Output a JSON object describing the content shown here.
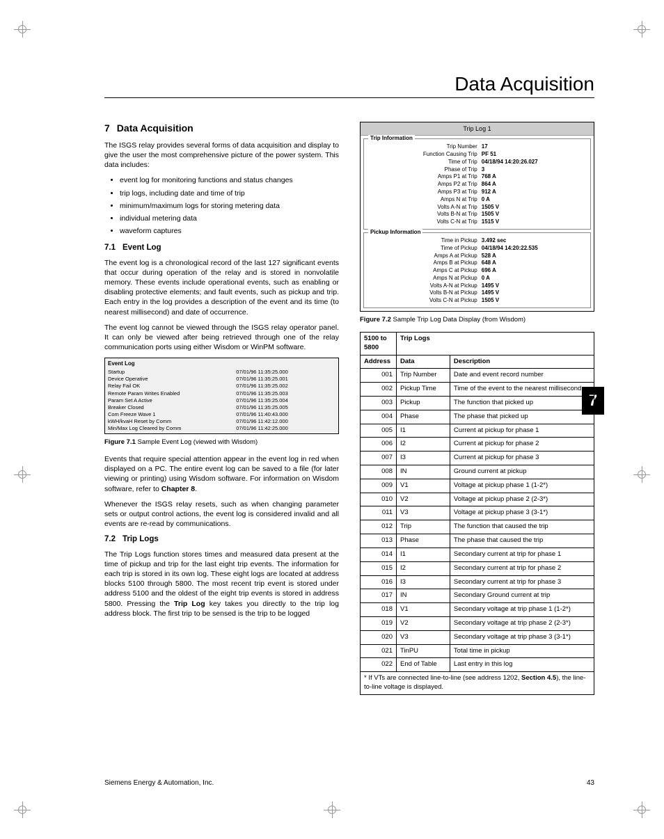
{
  "pageTitle": "Data Acquisition",
  "chapterTab": "7",
  "h7": {
    "num": "7",
    "title": "Data Acquisition"
  },
  "intro": "The ISGS relay provides several forms of data acquisition and display to give the user the most comprehensive picture of the power system. This data includes:",
  "bullets": [
    "event log for monitoring functions and status changes",
    "trip logs, including date and time of trip",
    "minimum/maximum logs for storing metering data",
    "individual metering data",
    "waveform captures"
  ],
  "h71": {
    "num": "7.1",
    "title": "Event Log"
  },
  "p71a": "The event log is a chronological record of the last 127 significant events that occur during operation of the relay and is stored in nonvolatile memory. These events include operational events, such as enabling or disabling protective elements; and fault events, such as pickup and trip. Each entry in the log provides a description of the event and its time (to nearest millisecond) and date of occurrence.",
  "p71b": "The event log cannot be viewed through the ISGS relay operator panel. It can only be viewed after being retrieved through one of the relay communication ports using either Wisdom or WinPM software.",
  "eventLog": {
    "header": "Event Log",
    "rows": [
      {
        "name": "Startup",
        "ts": "07/01/96 11:35:25.000"
      },
      {
        "name": "Device Operative",
        "ts": "07/01/96 11:35:25.001"
      },
      {
        "name": "Relay Fail OK",
        "ts": "07/01/96 11:35:25.002"
      },
      {
        "name": "Remote Param Writes Enabled",
        "ts": "07/01/96 11:35:25.003"
      },
      {
        "name": "Param Set A Active",
        "ts": "07/01/96 11:35:25.004"
      },
      {
        "name": "Breaker Closed",
        "ts": "07/01/96 11:35:25.005"
      },
      {
        "name": "Com Freeze Wave 1",
        "ts": "07/01/96 11:40:43.000"
      },
      {
        "name": "kWH/kvaH Reset by Comm",
        "ts": "07/01/96 11:42:12.000"
      },
      {
        "name": "Min/Max Log Cleared by Comm",
        "ts": "07/01/96 11:42:25.000"
      }
    ]
  },
  "fig71_label": "Figure 7.1",
  "fig71_text": " Sample Event Log (viewed with Wisdom)",
  "p71c_a": "Events that require special attention appear in the event log in red when displayed on a PC. The entire event log can be saved to a file (for later viewing or printing) using Wisdom software. For information on Wisdom software, refer to ",
  "p71c_bold": "Chapter 8",
  "p71c_b": ".",
  "p71d": "Whenever the ISGS relay resets, such as when changing parameter sets or output control actions, the event log is considered invalid and all events are re-read by communications.",
  "h72": {
    "num": "7.2",
    "title": "Trip Logs"
  },
  "p72a_a": "The Trip Logs function stores times and measured data present at the time of pickup and trip for the last eight trip events. The information for each trip is stored in its own log. These eight logs are located at address blocks 5100 through 5800. The most recent trip event is stored under address 5100 and the oldest of the eight trip events is stored in address 5800. Pressing the ",
  "p72a_bold": "Trip Log",
  "p72a_b": " key takes you directly to the trip log address block. The first trip to be sensed is the trip to be logged",
  "tripBox": {
    "title": "Trip Log 1",
    "tripInfoLegend": "Trip Information",
    "tripInfo": [
      {
        "k": "Trip Number",
        "v": "17"
      },
      {
        "k": "Function Causing Trip",
        "v": "PF 51"
      },
      {
        "k": "Time of Trip",
        "v": "04/18/94 14:20:26.027"
      },
      {
        "k": "Phase of Trip",
        "v": "3"
      },
      {
        "k": "Amps P1 at Trip",
        "v": "768 A"
      },
      {
        "k": "Amps P2 at Trip",
        "v": "864 A"
      },
      {
        "k": "Amps P3 at Trip",
        "v": "912 A"
      },
      {
        "k": "Amps N at Trip",
        "v": "0 A"
      },
      {
        "k": "Volts A-N at Trip",
        "v": "1505 V"
      },
      {
        "k": "Volts B-N at Trip",
        "v": "1505 V"
      },
      {
        "k": "Volts C-N at Trip",
        "v": "1515 V"
      }
    ],
    "pickupInfoLegend": "Pickup Information",
    "pickupInfo": [
      {
        "k": "Time in Pickup",
        "v": "3.492 sec"
      },
      {
        "k": "Time of Pickup",
        "v": "04/18/94 14:20:22.535"
      },
      {
        "k": "Amps A at Pickup",
        "v": "528 A"
      },
      {
        "k": "Amps B at Pickup",
        "v": "648 A"
      },
      {
        "k": "Amps C at Pickup",
        "v": "696 A"
      },
      {
        "k": "Amps N at Pickup",
        "v": "0 A"
      },
      {
        "k": "Volts A-N at Pickup",
        "v": "1495 V"
      },
      {
        "k": "Volts B-N at Pickup",
        "v": "1495 V"
      },
      {
        "k": "Volts C-N at Pickup",
        "v": "1505 V"
      }
    ]
  },
  "fig72_label": "Figure 7.2",
  "fig72_text": " Sample Trip Log Data Display (from Wisdom)",
  "tripTable": {
    "range": "5100 to 5800",
    "rangeLabel": "Trip Logs",
    "cols": {
      "addr": "Address",
      "data": "Data",
      "desc": "Description"
    },
    "rows": [
      {
        "a": "001",
        "d": "Trip Number",
        "desc": "Date and event record number"
      },
      {
        "a": "002",
        "d": "Pickup Time",
        "desc": "Time of the event to the nearest millisecond"
      },
      {
        "a": "003",
        "d": "Pickup",
        "desc": "The function that picked up"
      },
      {
        "a": "004",
        "d": "Phase",
        "desc": "The phase that picked up"
      },
      {
        "a": "005",
        "d": "I1",
        "desc": "Current at pickup for phase 1"
      },
      {
        "a": "006",
        "d": "I2",
        "desc": "Current at pickup for phase 2"
      },
      {
        "a": "007",
        "d": "I3",
        "desc": "Current at pickup for phase 3"
      },
      {
        "a": "008",
        "d": "IN",
        "desc": "Ground current at pickup"
      },
      {
        "a": "009",
        "d": "V1",
        "desc": "Voltage at pickup phase 1 (1-2*)"
      },
      {
        "a": "010",
        "d": "V2",
        "desc": "Voltage at pickup phase 2 (2-3*)"
      },
      {
        "a": "011",
        "d": "V3",
        "desc": "Voltage at pickup phase 3 (3-1*)"
      },
      {
        "a": "012",
        "d": "Trip",
        "desc": "The function that caused the trip"
      },
      {
        "a": "013",
        "d": "Phase",
        "desc": "The phase that caused the trip"
      },
      {
        "a": "014",
        "d": "I1",
        "desc": "Secondary current at trip for phase 1"
      },
      {
        "a": "015",
        "d": "I2",
        "desc": "Secondary current at trip for phase 2"
      },
      {
        "a": "016",
        "d": "I3",
        "desc": "Secondary current at trip for phase 3"
      },
      {
        "a": "017",
        "d": "IN",
        "desc": "Secondary Ground current at trip"
      },
      {
        "a": "018",
        "d": "V1",
        "desc": "Secondary voltage at trip phase 1 (1-2*)"
      },
      {
        "a": "019",
        "d": "V2",
        "desc": "Secondary voltage at trip phase 2 (2-3*)"
      },
      {
        "a": "020",
        "d": "V3",
        "desc": "Secondary voltage at trip phase 3 (3-1*)"
      },
      {
        "a": "021",
        "d": "TinPU",
        "desc": "Total time in pickup"
      },
      {
        "a": "022",
        "d": "End of Table",
        "desc": "Last entry in this log"
      }
    ],
    "footnote_a": "* If VTs are connected line-to-line (see address 1202, ",
    "footnote_bold": "Section 4.5",
    "footnote_b": "), the line-to-line voltage is displayed."
  },
  "footerLeft": "Siemens Energy & Automation, Inc.",
  "footerRight": "43"
}
